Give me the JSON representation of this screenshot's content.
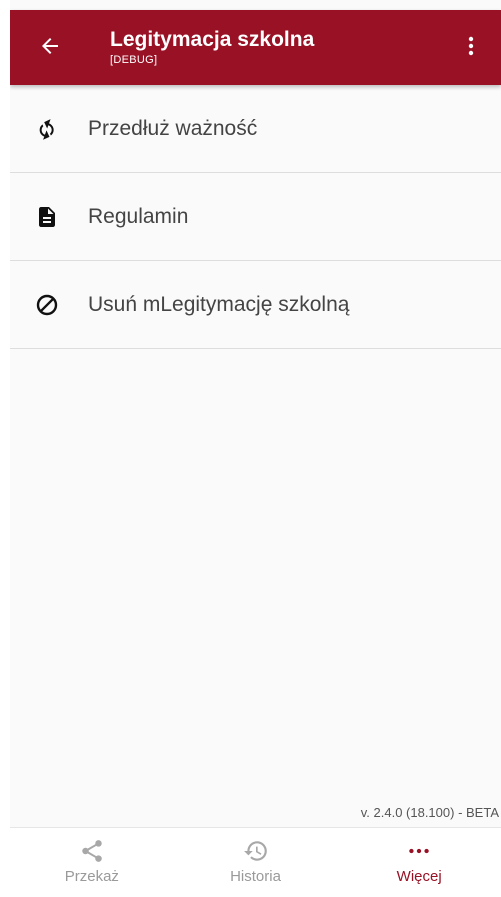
{
  "colors": {
    "brand": "#981125",
    "app_bar_text": "#ffffff",
    "inactive": "#9a9a9a"
  },
  "app_bar": {
    "title": "Legitymacja szkolna",
    "subtitle": "[DEBUG]",
    "back_icon": "arrow-left-icon",
    "overflow_icon": "more-vert-icon"
  },
  "menu": {
    "items": [
      {
        "label": "Przedłuż ważność",
        "icon": "refresh-icon"
      },
      {
        "label": "Regulamin",
        "icon": "document-icon"
      },
      {
        "label": "Usuń mLegitymację szkolną",
        "icon": "block-icon"
      }
    ]
  },
  "version": "v. 2.4.0 (18.100) - BETA",
  "bottom_nav": {
    "items": [
      {
        "label": "Przekaż",
        "icon": "share-icon",
        "active": false
      },
      {
        "label": "Historia",
        "icon": "history-icon",
        "active": false
      },
      {
        "label": "Więcej",
        "icon": "more-horiz-icon",
        "active": true
      }
    ]
  }
}
